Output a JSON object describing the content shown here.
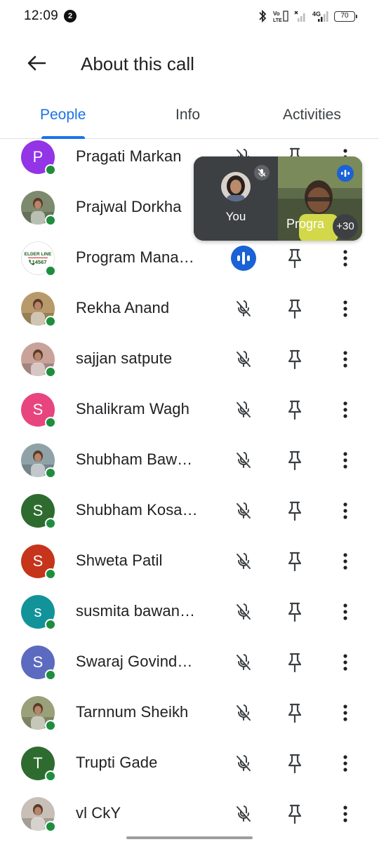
{
  "status_bar": {
    "time": "12:09",
    "notification_count": "2",
    "network": "4G",
    "battery": "70"
  },
  "app_bar": {
    "title": "About this call"
  },
  "tabs": [
    {
      "label": "People",
      "active": true
    },
    {
      "label": "Info",
      "active": false
    },
    {
      "label": "Activities",
      "active": false
    }
  ],
  "participants": [
    {
      "name": "Pragati Markan",
      "avatar_letter": "P",
      "avatar_color": "#9334e6",
      "photo": false,
      "mic": "muted"
    },
    {
      "name": "Prajwal Dorkha",
      "avatar_letter": "",
      "avatar_color": "#7d8a6e",
      "photo": true,
      "mic": "muted"
    },
    {
      "name": "Program Mana…",
      "avatar_letter": "",
      "avatar_color": "#ffffff",
      "photo": true,
      "mic": "speaking"
    },
    {
      "name": "Rekha Anand",
      "avatar_letter": "",
      "avatar_color": "#b89a6a",
      "photo": true,
      "mic": "muted"
    },
    {
      "name": "sajjan satpute",
      "avatar_letter": "",
      "avatar_color": "#c9a29a",
      "photo": true,
      "mic": "muted"
    },
    {
      "name": "Shalikram Wagh",
      "avatar_letter": "S",
      "avatar_color": "#e8457f",
      "photo": false,
      "mic": "muted"
    },
    {
      "name": "Shubham Baw…",
      "avatar_letter": "",
      "avatar_color": "#8fa2a8",
      "photo": true,
      "mic": "muted"
    },
    {
      "name": "Shubham Kosa…",
      "avatar_letter": "S",
      "avatar_color": "#2e6b2f",
      "photo": false,
      "mic": "muted"
    },
    {
      "name": "Shweta Patil",
      "avatar_letter": "S",
      "avatar_color": "#c5341b",
      "photo": false,
      "mic": "muted"
    },
    {
      "name": "susmita bawan…",
      "avatar_letter": "s",
      "avatar_color": "#12939a",
      "photo": false,
      "mic": "muted"
    },
    {
      "name": "Swaraj Govind…",
      "avatar_letter": "S",
      "avatar_color": "#5c6bc0",
      "photo": false,
      "mic": "muted"
    },
    {
      "name": "Tarnnum Sheikh",
      "avatar_letter": "",
      "avatar_color": "#9aa07a",
      "photo": true,
      "mic": "muted"
    },
    {
      "name": "Trupti Gade",
      "avatar_letter": "T",
      "avatar_color": "#2e6b2f",
      "photo": false,
      "mic": "muted"
    },
    {
      "name": "vl CkY",
      "avatar_letter": "",
      "avatar_color": "#c8c0b8",
      "photo": true,
      "mic": "muted"
    }
  ],
  "preview": {
    "self_label": "You",
    "remote_name": "Progra",
    "more_count": "+30"
  },
  "logos": {
    "elder_line": "ELDER LINE",
    "elder_line_number": "14567"
  },
  "colors": {
    "accent": "#1a73e8",
    "online": "#1e8e3e",
    "speaking": "#1a62d6"
  }
}
